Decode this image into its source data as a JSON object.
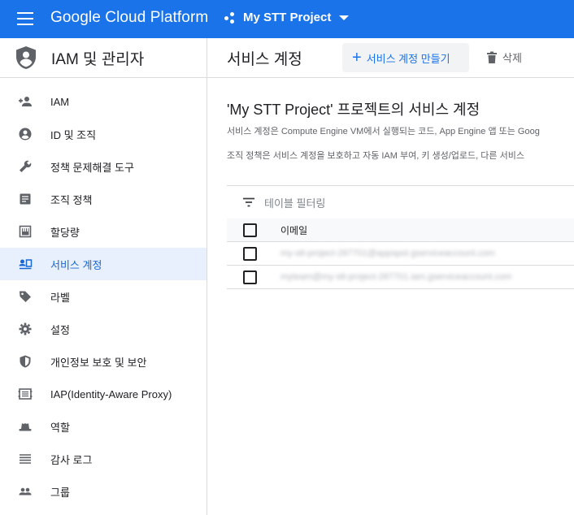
{
  "header": {
    "brand": "Google Cloud Platform",
    "project": "My STT Project"
  },
  "sidebar": {
    "title": "IAM 및 관리자",
    "items": [
      {
        "label": "IAM",
        "icon": "person-add-icon"
      },
      {
        "label": "ID 및 조직",
        "icon": "account-circle-icon"
      },
      {
        "label": "정책 문제해결 도구",
        "icon": "wrench-icon"
      },
      {
        "label": "조직 정책",
        "icon": "document-icon"
      },
      {
        "label": "할당량",
        "icon": "quota-icon"
      },
      {
        "label": "서비스 계정",
        "icon": "service-account-icon"
      },
      {
        "label": "라벨",
        "icon": "label-icon"
      },
      {
        "label": "설정",
        "icon": "gear-icon"
      },
      {
        "label": "개인정보 보호 및 보안",
        "icon": "shield-icon"
      },
      {
        "label": "IAP(Identity-Aware Proxy)",
        "icon": "iap-icon"
      },
      {
        "label": "역할",
        "icon": "hat-icon"
      },
      {
        "label": "감사 로그",
        "icon": "list-icon"
      },
      {
        "label": "그룹",
        "icon": "group-icon"
      }
    ],
    "active_index": 5
  },
  "main": {
    "title": "서비스 계정",
    "create_label": "서비스 계정 만들기",
    "delete_label": "삭제",
    "section_title": "'My STT Project' 프로젝트의 서비스 계정",
    "desc1": "서비스 계정은 Compute Engine VM에서 실행되는 코드, App Engine 앱 또는 Goog",
    "desc2": "조직 정책은 서비스 계정을 보호하고 자동 IAM 부여, 키 생성/업로드, 다른 서비스",
    "filter_placeholder": "테이블 필터링",
    "table": {
      "header_email": "이메일",
      "rows": [
        {
          "email": "my-stt-project-287701@appspot.gserviceaccount.com"
        },
        {
          "email": "myteam@my-stt-project-287701.iam.gserviceaccount.com"
        }
      ]
    }
  },
  "colors": {
    "topbar": "#1a73e8",
    "active_bg": "#e8f0fe",
    "active_text": "#1967d2"
  }
}
